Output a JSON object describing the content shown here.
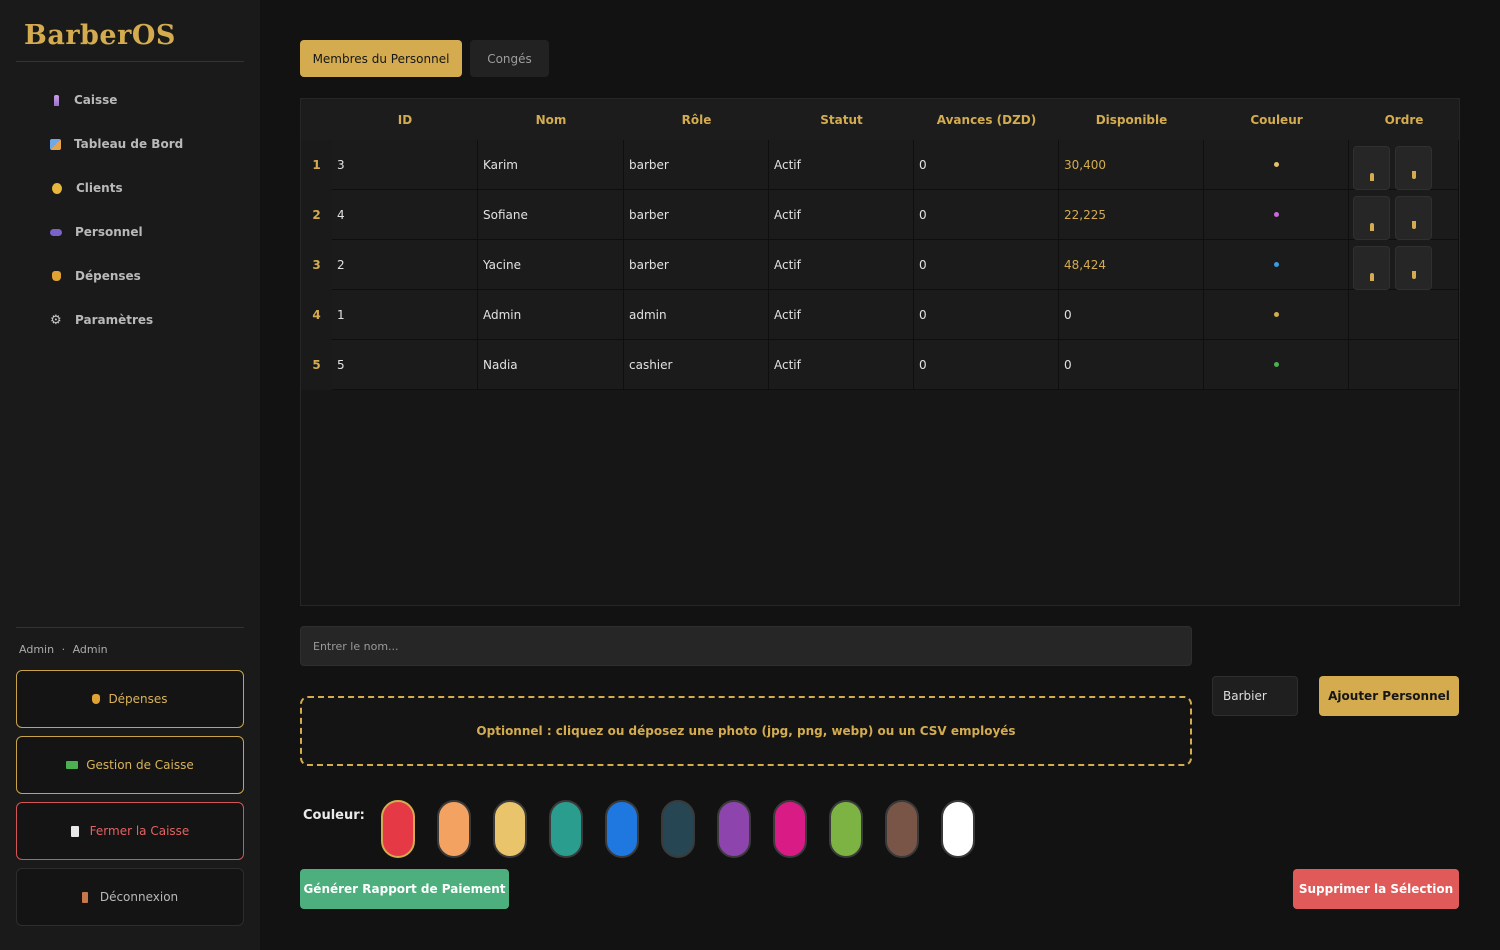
{
  "app": {
    "brand": "BarberOS"
  },
  "sidebar": {
    "nav": [
      {
        "label": "Caisse",
        "icon": "pin-icon"
      },
      {
        "label": "Tableau de Bord",
        "icon": "chart-icon"
      },
      {
        "label": "Clients",
        "icon": "face-icon"
      },
      {
        "label": "Personnel",
        "icon": "users-icon"
      },
      {
        "label": "Dépenses",
        "icon": "money-bag-icon"
      },
      {
        "label": "Paramètres",
        "icon": "gear-icon"
      }
    ],
    "user": {
      "name": "Admin",
      "separator": "·",
      "role": "Admin"
    },
    "buttons": {
      "depenses": "Dépenses",
      "gestion": "Gestion de Caisse",
      "fermer": "Fermer la Caisse",
      "logout": "Déconnexion"
    }
  },
  "tabs": [
    {
      "label": "Membres du Personnel",
      "active": true
    },
    {
      "label": "Congés",
      "active": false
    }
  ],
  "table": {
    "columns": [
      "ID",
      "Nom",
      "Rôle",
      "Statut",
      "Avances (DZD)",
      "Disponible",
      "Couleur",
      "Ordre"
    ],
    "rows": [
      {
        "index": "1",
        "id": "3",
        "nom": "Karim",
        "role": "barber",
        "statut": "Actif",
        "avances": "0",
        "disponible": "30,400",
        "couleur": "#e8c06a",
        "ordre": true
      },
      {
        "index": "2",
        "id": "4",
        "nom": "Sofiane",
        "role": "barber",
        "statut": "Actif",
        "avances": "0",
        "disponible": "22,225",
        "couleur": "#c86ad9",
        "ordre": true
      },
      {
        "index": "3",
        "id": "2",
        "nom": "Yacine",
        "role": "barber",
        "statut": "Actif",
        "avances": "0",
        "disponible": "48,424",
        "couleur": "#3b9be0",
        "ordre": true
      },
      {
        "index": "4",
        "id": "1",
        "nom": "Admin",
        "role": "admin",
        "statut": "Actif",
        "avances": "0",
        "disponible": "0",
        "couleur": "#d4ac4f",
        "ordre": false
      },
      {
        "index": "5",
        "id": "5",
        "nom": "Nadia",
        "role": "cashier",
        "statut": "Actif",
        "avances": "0",
        "disponible": "0",
        "couleur": "#4caf50",
        "ordre": false
      }
    ]
  },
  "form": {
    "name_placeholder": "Entrer le nom...",
    "dropzone_text": "Optionnel : cliquez ou déposez une photo (jpg, png, webp) ou un CSV employés",
    "role_value": "Barbier",
    "add_label": "Ajouter Personnel",
    "color_label": "Couleur:",
    "colors": [
      "#e63946",
      "#f4a261",
      "#e9c46a",
      "#2a9d8f",
      "#1f78e0",
      "#264653",
      "#8e44ad",
      "#d81b85",
      "#7cb342",
      "#795548",
      "#ffffff"
    ],
    "selected_color_index": 0
  },
  "actions": {
    "report_label": "Générer Rapport de Paiement",
    "delete_label": "Supprimer la Sélection"
  },
  "theme": {
    "accent": "#d4ac4f",
    "success": "#4caf7d",
    "danger": "#e05a5a"
  }
}
